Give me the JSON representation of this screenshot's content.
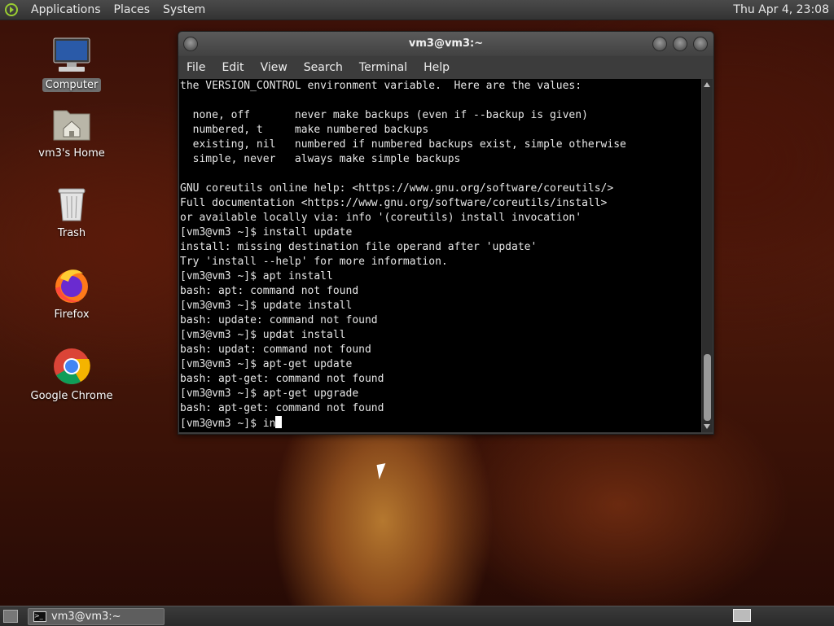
{
  "top_panel": {
    "menus": [
      "Applications",
      "Places",
      "System"
    ],
    "clock": "Thu Apr  4, 23:08"
  },
  "desktop": {
    "icons": [
      {
        "label": "Computer",
        "icon": "computer-icon"
      },
      {
        "label": "vm3's Home",
        "icon": "home-folder-icon"
      },
      {
        "label": "Trash",
        "icon": "trash-icon"
      },
      {
        "label": "Firefox",
        "icon": "firefox-icon"
      },
      {
        "label": "Google Chrome",
        "icon": "chrome-icon"
      }
    ]
  },
  "terminal": {
    "title": "vm3@vm3:~",
    "menu": [
      "File",
      "Edit",
      "View",
      "Search",
      "Terminal",
      "Help"
    ],
    "lines": [
      "the VERSION_CONTROL environment variable.  Here are the values:",
      "",
      "  none, off       never make backups (even if --backup is given)",
      "  numbered, t     make numbered backups",
      "  existing, nil   numbered if numbered backups exist, simple otherwise",
      "  simple, never   always make simple backups",
      "",
      "GNU coreutils online help: <https://www.gnu.org/software/coreutils/>",
      "Full documentation <https://www.gnu.org/software/coreutils/install>",
      "or available locally via: info '(coreutils) install invocation'",
      "[vm3@vm3 ~]$ install update",
      "install: missing destination file operand after 'update'",
      "Try 'install --help' for more information.",
      "[vm3@vm3 ~]$ apt install",
      "bash: apt: command not found",
      "[vm3@vm3 ~]$ update install",
      "bash: update: command not found",
      "[vm3@vm3 ~]$ updat install",
      "bash: updat: command not found",
      "[vm3@vm3 ~]$ apt-get update",
      "bash: apt-get: command not found",
      "[vm3@vm3 ~]$ apt-get upgrade",
      "bash: apt-get: command not found"
    ],
    "prompt": "[vm3@vm3 ~]$ ",
    "input": "in"
  },
  "taskbar": {
    "window_button": "vm3@vm3:~"
  }
}
